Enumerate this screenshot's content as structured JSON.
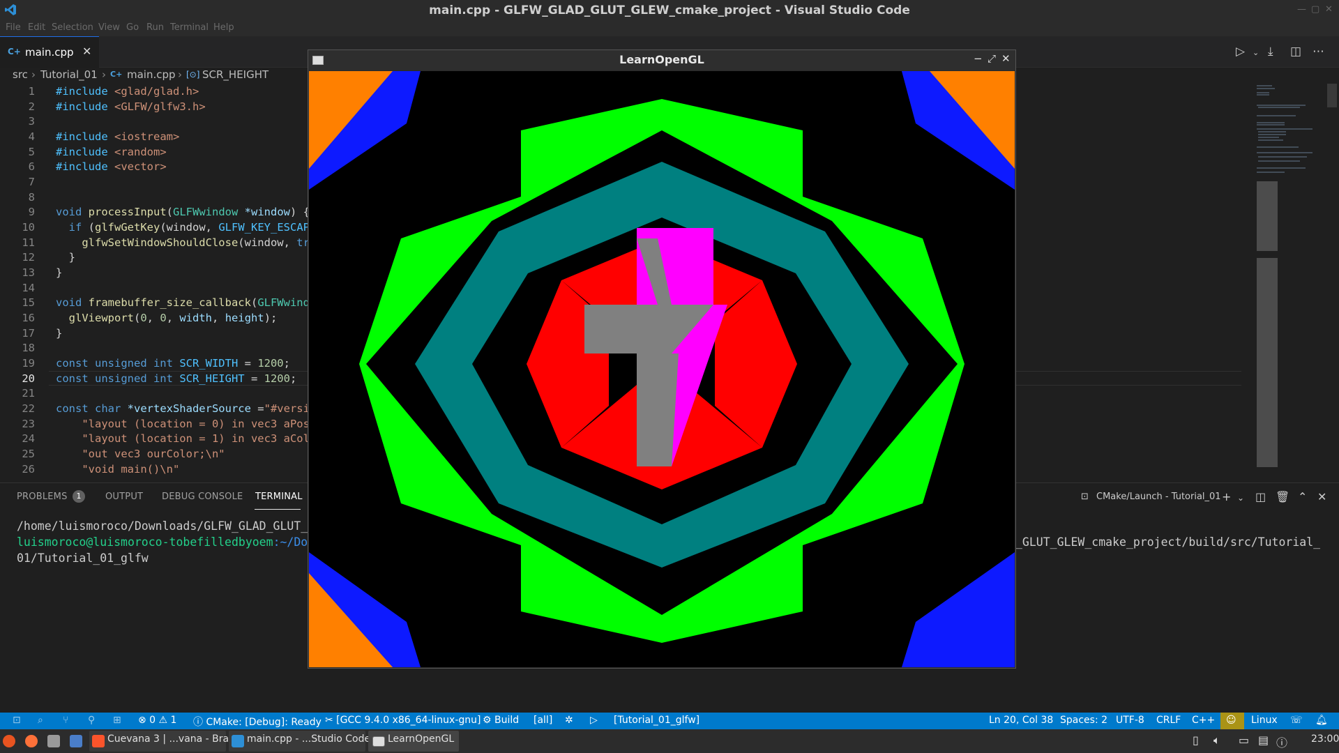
{
  "window": {
    "title": "main.cpp - GLFW_GLAD_GLUT_GLEW_cmake_project - Visual Studio Code"
  },
  "menu": [
    "File",
    "Edit",
    "Selection",
    "View",
    "Go",
    "Run",
    "Terminal",
    "Help"
  ],
  "tab": {
    "icon_text": "C+",
    "label": "main.cpp",
    "close": "✕"
  },
  "breadcrumb": {
    "folder1": "src",
    "folder2": "Tutorial_01",
    "file_icon": "C+",
    "file": "main.cpp",
    "symbol_icon": "[⊙]",
    "symbol": "SCR_HEIGHT"
  },
  "editor": {
    "line_numbers": [
      "1",
      "2",
      "3",
      "4",
      "5",
      "6",
      "7",
      "8",
      "9",
      "10",
      "11",
      "12",
      "13",
      "14",
      "15",
      "16",
      "17",
      "18",
      "19",
      "20",
      "21",
      "22",
      "23",
      "24",
      "25",
      "26"
    ],
    "current_line": "20"
  },
  "panel": {
    "tabs": {
      "problems": "PROBLEMS",
      "problems_count": "1",
      "output": "OUTPUT",
      "debug": "DEBUG CONSOLE",
      "terminal": "TERMINAL"
    },
    "launch_target": "CMake/Launch - Tutorial_01",
    "terminal_lines": {
      "l1": "/home/luismoroco/Downloads/GLFW_GLAD_GLUT_",
      "l2_user": "luismoroco@luismoroco-tobefilledbyoem",
      "l2_path": ":~/Do",
      "l2_right": "_GLUT_GLEW_cmake_project/build/src/Tutorial_",
      "l3": "01/Tutorial_01_glfw"
    }
  },
  "statusbar": {
    "errors": "⊗ 0 ⚠ 1",
    "cmake": "ⓘ CMake: [Debug]: Ready",
    "kit": "✂ [GCC 9.4.0 x86_64-linux-gnu]",
    "build": "⚙ Build",
    "target": "[all]",
    "launch": "[Tutorial_01_glfw]",
    "position": "Ln 20, Col 38",
    "spaces": "Spaces: 2",
    "encoding": "UTF-8",
    "eol": "CRLF",
    "language": "C++",
    "os": "Linux"
  },
  "taskbar": {
    "brave": "Cuevana 3 | ...vana - Brave",
    "vscode": "main.cpp - ...Studio Code",
    "gl": "LearnOpenGL",
    "clock": "23:00"
  },
  "glwindow": {
    "title": "LearnOpenGL",
    "controls": [
      "−",
      "⤢",
      "✕"
    ],
    "colors": {
      "orange": "#ff8000",
      "blue": "#0d1aff",
      "green": "#00ff00",
      "teal": "#008080",
      "red": "#ff0000",
      "magenta": "#ff00ff",
      "gray": "#808080",
      "black": "#000000"
    }
  }
}
